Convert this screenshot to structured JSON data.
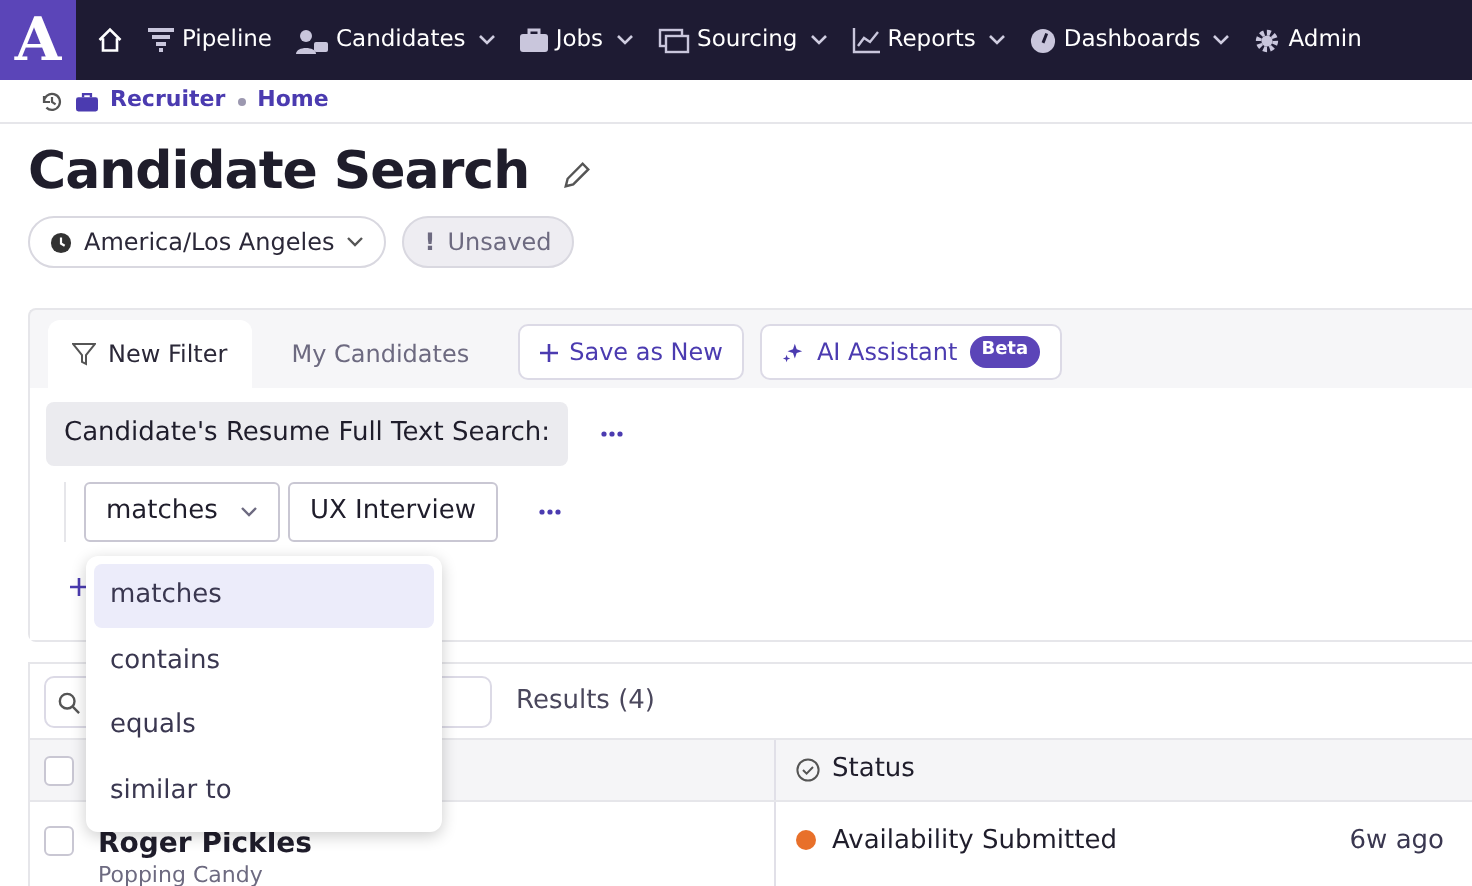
{
  "nav": {
    "logo": "A",
    "items": [
      {
        "kind": "home"
      },
      {
        "kind": "pipeline",
        "label": "Pipeline",
        "has_menu": false
      },
      {
        "kind": "candidates",
        "label": "Candidates",
        "has_menu": true
      },
      {
        "kind": "jobs",
        "label": "Jobs",
        "has_menu": true
      },
      {
        "kind": "sourcing",
        "label": "Sourcing",
        "has_menu": true
      },
      {
        "kind": "reports",
        "label": "Reports",
        "has_menu": true
      },
      {
        "kind": "dashboards",
        "label": "Dashboards",
        "has_menu": true
      },
      {
        "kind": "admin",
        "label": "Admin",
        "has_menu": false
      }
    ]
  },
  "breadcrumb": [
    "Recruiter",
    "Home"
  ],
  "title": "Candidate Search",
  "timezone": "America/Los Angeles",
  "save_state": {
    "mark": "!",
    "label": "Unsaved"
  },
  "tabs": [
    {
      "label": "New Filter",
      "selected": true
    },
    {
      "label": "My Candidates",
      "selected": false
    }
  ],
  "actions": [
    {
      "kind": "save",
      "label": "Save as New"
    },
    {
      "kind": "ai",
      "label": "AI Assistant",
      "badge": "Beta"
    }
  ],
  "filter": {
    "field": "Candidate's Resume Full Text Search:",
    "operator": "matches",
    "value": "UX Interview"
  },
  "operator_menu": [
    {
      "label": "matches",
      "selected": true
    },
    {
      "label": "contains",
      "selected": false
    },
    {
      "label": "equals",
      "selected": false
    },
    {
      "label": "similar to",
      "selected": false
    }
  ],
  "results_label": "Results (4)",
  "table": {
    "select_all_checked": false,
    "status_header": "Status",
    "rows": [
      {
        "checked": false,
        "name": "Roger Pickles",
        "subtitle": "Popping Candy",
        "status": "Availability Submitted",
        "color": "#e8702a",
        "time": "6w ago"
      }
    ]
  }
}
